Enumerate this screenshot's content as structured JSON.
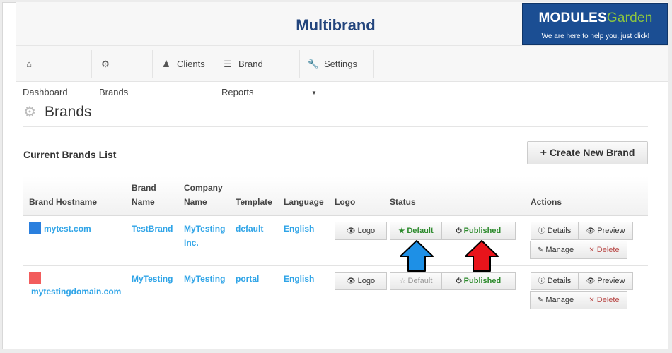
{
  "app": {
    "title": "Multibrand",
    "logo_part1": "MODULES",
    "logo_part2": "Garden",
    "logo_tagline": "We are here to help you, just click!"
  },
  "nav": {
    "items": [
      {
        "label": "Dashboard",
        "icon": "home-icon"
      },
      {
        "label": "Brands",
        "icon": "cogs-icon"
      },
      {
        "label": "Clients",
        "icon": "user-icon"
      },
      {
        "label": "Brand Reports",
        "icon": "list-icon"
      },
      {
        "label": "Settings",
        "icon": "wrench-icon"
      }
    ]
  },
  "page": {
    "title": "Brands",
    "list_title": "Current Brands List",
    "create_button": "Create New Brand"
  },
  "table": {
    "headers": {
      "hostname": "Brand Hostname",
      "brand_name_1": "Brand",
      "brand_name_2": "Name",
      "company_1": "Company",
      "company_2": "Name",
      "template": "Template",
      "language": "Language",
      "logo": "Logo",
      "status": "Status",
      "actions": "Actions"
    },
    "rows": [
      {
        "swatch_color": "#2a7fde",
        "hostname": "mytest.com",
        "brand_name": "TestBrand",
        "company_1": "MyTesting",
        "company_2": "Inc.",
        "template": "default",
        "language": "English",
        "logo_btn": "Logo",
        "default_btn": "Default",
        "default_active": true,
        "published_btn": "Published",
        "details_btn": "Details",
        "preview_btn": "Preview",
        "manage_btn": "Manage",
        "delete_btn": "Delete"
      },
      {
        "swatch_color": "#f25c5c",
        "hostname": "mytestingdomain.com",
        "brand_name": "MyTesting",
        "company_1": "MyTesting",
        "company_2": "",
        "template": "portal",
        "language": "English",
        "logo_btn": "Logo",
        "default_btn": "Default",
        "default_active": false,
        "published_btn": "Published",
        "details_btn": "Details",
        "preview_btn": "Preview",
        "manage_btn": "Manage",
        "delete_btn": "Delete"
      }
    ]
  },
  "annotations": {
    "arrow_1_color": "#1e90e6",
    "arrow_2_color": "#e8141b"
  }
}
